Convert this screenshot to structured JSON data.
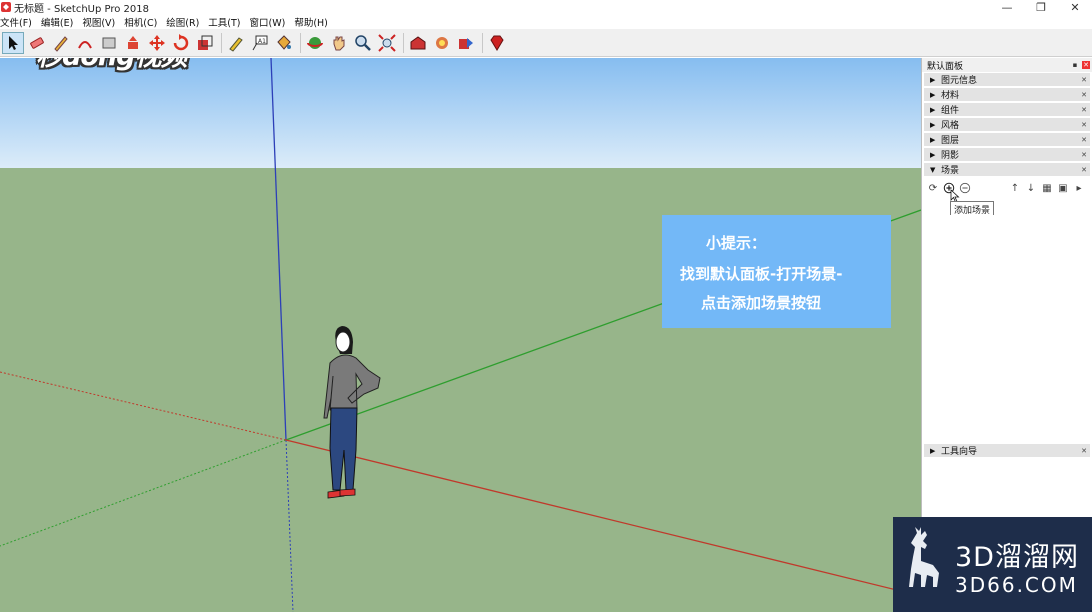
{
  "window": {
    "title": "无标题 - SketchUp Pro 2018",
    "minimize": "—",
    "restore": "❐",
    "close": "✕"
  },
  "menu": [
    "文件(F)",
    "编辑(E)",
    "视图(V)",
    "相机(C)",
    "绘图(R)",
    "工具(T)",
    "窗口(W)",
    "帮助(H)"
  ],
  "watermark_top": "秒dong视频",
  "tip": {
    "line1": "小提示：",
    "line2": "找到默认面板-打开场景-",
    "line3": "点击添加场景按钮"
  },
  "panel": {
    "title": "默认面板",
    "trays": [
      {
        "label": "图元信息",
        "expanded": false
      },
      {
        "label": "材料",
        "expanded": false
      },
      {
        "label": "组件",
        "expanded": false
      },
      {
        "label": "风格",
        "expanded": false
      },
      {
        "label": "图层",
        "expanded": false
      },
      {
        "label": "阴影",
        "expanded": false
      },
      {
        "label": "场景",
        "expanded": true
      }
    ],
    "tooltip": "添加场景",
    "bottom_tray": {
      "label": "工具向导",
      "expanded": false
    }
  },
  "logo": {
    "line1": "3D溜溜网",
    "line2": "3D66.COM"
  },
  "colors": {
    "sky_top": "#86bdf0",
    "ground": "#97b58a",
    "tip_bg": "#73b8f7",
    "axis_red": "#c0392b",
    "axis_green": "#2e9e2e",
    "axis_blue": "#2c3fb8",
    "logo_bg": "#1e2d4a"
  }
}
